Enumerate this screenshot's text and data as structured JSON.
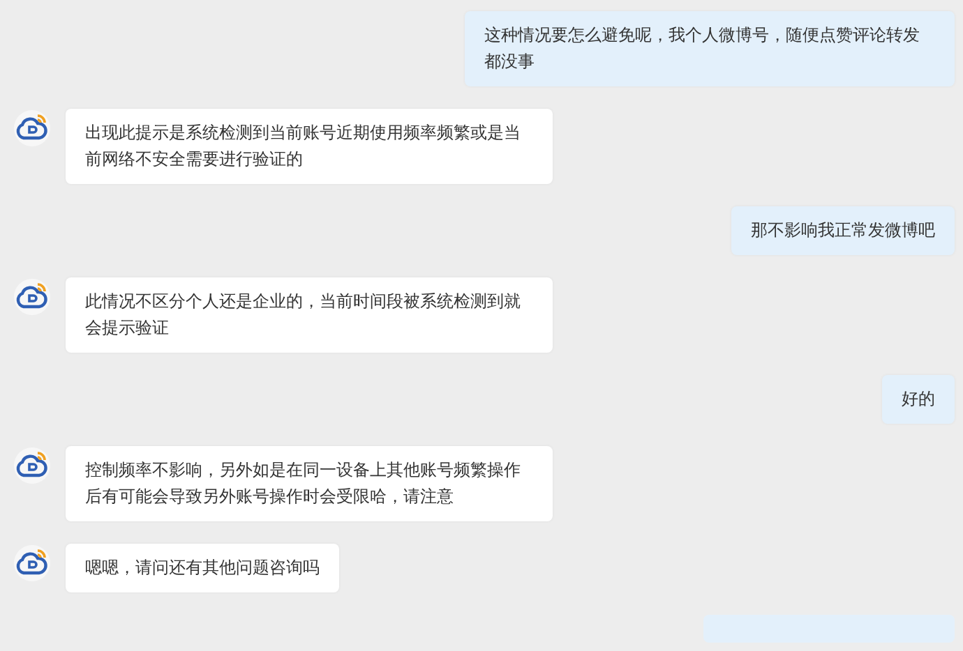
{
  "messages": [
    {
      "kind": "user",
      "text": "这种情况要怎么避免呢，我个人微博号，随便点赞评论转发都没事"
    },
    {
      "kind": "bot",
      "text": "出现此提示是系统检测到当前账号近期使用频率频繁或是当前网络不安全需要进行验证的"
    },
    {
      "kind": "user",
      "text": "那不影响我正常发微博吧"
    },
    {
      "kind": "bot",
      "text": "此情况不区分个人还是企业的，当前时间段被系统检测到就会提示验证"
    },
    {
      "kind": "user",
      "text": "好的"
    },
    {
      "kind": "bot",
      "text": "控制频率不影响，另外如是在同一设备上其他账号频繁操作后有可能会导致另外账号操作时会受限哈，请注意"
    },
    {
      "kind": "bot",
      "text": "嗯嗯，请问还有其他问题咨询吗"
    }
  ]
}
